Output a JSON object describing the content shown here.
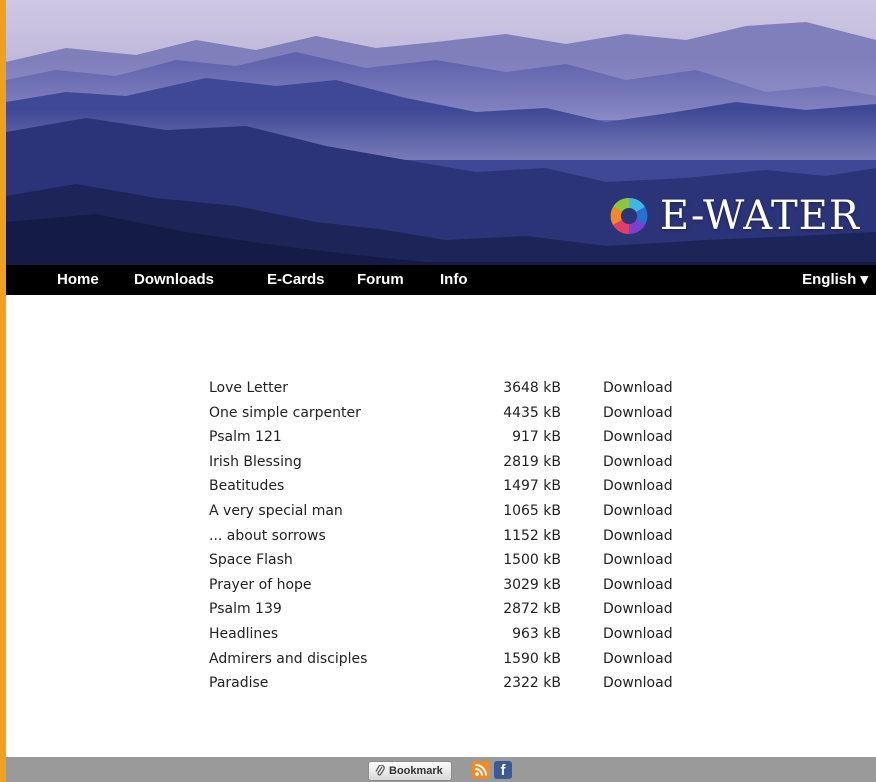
{
  "logo": {
    "text": "E-WATER"
  },
  "nav": {
    "items": [
      "Home",
      "Downloads",
      "E-Cards",
      "Forum",
      "Info"
    ],
    "language": "English ▾"
  },
  "downloads": [
    {
      "title": "Love Letter",
      "size": "3648 kB",
      "action": "Download"
    },
    {
      "title": "One simple carpenter",
      "size": "4435 kB",
      "action": "Download"
    },
    {
      "title": "Psalm 121",
      "size": "917 kB",
      "action": "Download"
    },
    {
      "title": "Irish Blessing",
      "size": "2819 kB",
      "action": "Download"
    },
    {
      "title": "Beatitudes",
      "size": "1497 kB",
      "action": "Download"
    },
    {
      "title": "A very special man",
      "size": "1065 kB",
      "action": "Download"
    },
    {
      "title": "... about sorrows",
      "size": "1152 kB",
      "action": "Download"
    },
    {
      "title": "Space Flash",
      "size": "1500 kB",
      "action": "Download"
    },
    {
      "title": "Prayer of hope",
      "size": "3029 kB",
      "action": "Download"
    },
    {
      "title": "Psalm 139",
      "size": "2872 kB",
      "action": "Download"
    },
    {
      "title": "Headlines",
      "size": "963 kB",
      "action": "Download"
    },
    {
      "title": "Admirers and disciples",
      "size": "1590 kB",
      "action": "Download"
    },
    {
      "title": "Paradise",
      "size": "2322 kB",
      "action": "Download"
    }
  ],
  "footer": {
    "bookmark_label": "Bookmark",
    "icons": [
      "paperclip-icon",
      "rss-icon",
      "facebook-icon"
    ]
  },
  "colors": {
    "outer_border": "#f0a020",
    "nav_bg": "#000000",
    "footer_bg": "#9a9a9a",
    "sky_top": "#c9c3e0",
    "mountains_dark": "#1c2458"
  }
}
